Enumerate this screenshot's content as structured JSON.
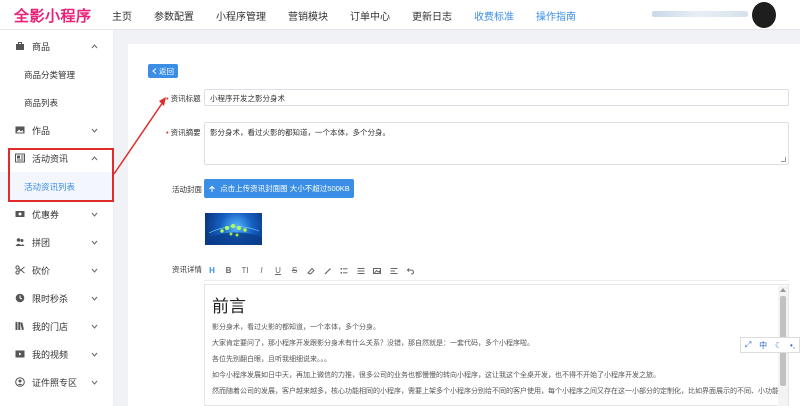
{
  "app": {
    "logo_text": "全影小程序"
  },
  "nav": [
    {
      "label": "主页"
    },
    {
      "label": "参数配置"
    },
    {
      "label": "小程序管理"
    },
    {
      "label": "营销模块"
    },
    {
      "label": "订单中心"
    },
    {
      "label": "更新日志"
    },
    {
      "label": "收费标准",
      "accent": true
    },
    {
      "label": "操作指南",
      "accent": true
    }
  ],
  "sidebar": {
    "goods": "商品",
    "goods_sub": [
      "商品分类管理",
      "商品列表"
    ],
    "works": "作品",
    "news": "活动资讯",
    "news_sub": "活动资讯列表",
    "coupon": "优惠券",
    "group": "拼团",
    "bargain": "砍价",
    "flash": "限时秒杀",
    "stores": "我的门店",
    "videos": "我的视频",
    "photo": "证件照专区"
  },
  "form": {
    "back_label": "返回",
    "title_label": "资讯标题",
    "title_value": "小程序开发之影分身术",
    "summary_label": "资讯摘要",
    "summary_value": "影分身术，看过火影的都知道，一个本体，多个分身。",
    "cover_label": "活动封面",
    "upload_label": "点击上传资讯封面图 大小不超过500KB",
    "detail_label": "资讯详情"
  },
  "editor": {
    "toolbar_first": "H",
    "toolbar_bold": "B",
    "toolbar_text": "TI",
    "toolbar_italic": "I",
    "toolbar_underline": "U",
    "toolbar_strike": "S",
    "heading": "前言",
    "paragraphs": [
      "影分身术，看过火影的都知道，一个本体，多个分身。",
      "大家肯定要问了，那小程序开发跟影分身术有什么关系？没错，那自然就是：一套代码，多个小程序啦。",
      "各位先别翻白眼，且听我细细说来。。。",
      "如今小程序发展如日中天，再加上微信的力推，很多公司的业务也都慢慢的转向小程序，这让我这个全桌开发，也不得不开始了小程序开发之旅。",
      "然而随着公司的发展，客户越来越多，核心功能相同的小程序，需要上架多个小程序分别给不同的客户使用，每个小程序之间又存在这一小部分的定制化，比如界面展示的不同、小功能的差异等等。"
    ]
  },
  "ime": {
    "lang": "中"
  },
  "colors": {
    "accent": "#3a8ee6",
    "brand": "#e8217a",
    "annotation": "#e02b2b"
  }
}
